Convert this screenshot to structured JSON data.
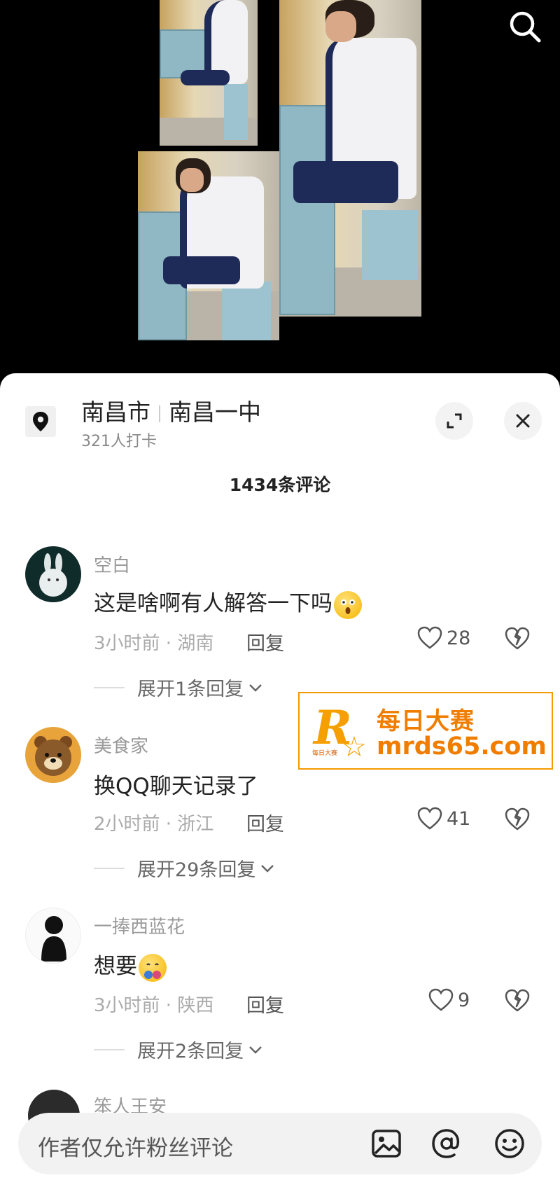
{
  "location": {
    "city": "南昌市",
    "place": "南昌一中",
    "checkins": "321人打卡"
  },
  "comments_count": "1434条评论",
  "comments": [
    {
      "user": "空白",
      "text": "这是啥啊有人解答一下吗",
      "meta": "3小时前 · 湖南",
      "reply_label": "回复",
      "likes": "28",
      "expand": "展开1条回复"
    },
    {
      "user": "美食家",
      "text": "换QQ聊天记录了",
      "meta": "2小时前 · 浙江",
      "reply_label": "回复",
      "likes": "41",
      "expand": "展开29条回复"
    },
    {
      "user": "一捧西蓝花",
      "text": "想要",
      "meta": "3小时前 · 陕西",
      "reply_label": "回复",
      "likes": "9",
      "expand": "展开2条回复"
    }
  ],
  "partial_user": "笨人王安",
  "watermark": {
    "logo_letter": "R",
    "logo_small": "每日大赛",
    "title": "每日大赛",
    "url": "mrds65.com"
  },
  "input": {
    "placeholder": "作者仅允许粉丝评论"
  },
  "icons": {
    "search": "search-icon",
    "location": "location-pin-icon",
    "expand": "expand-icon",
    "close": "close-icon",
    "like": "heart-icon",
    "dislike": "broken-heart-icon",
    "chevron": "chevron-down-icon",
    "image": "image-icon",
    "mention": "at-icon",
    "emoji": "emoji-icon"
  },
  "colors": {
    "watermark": "#f07d00",
    "sheet": "#ffffff"
  }
}
